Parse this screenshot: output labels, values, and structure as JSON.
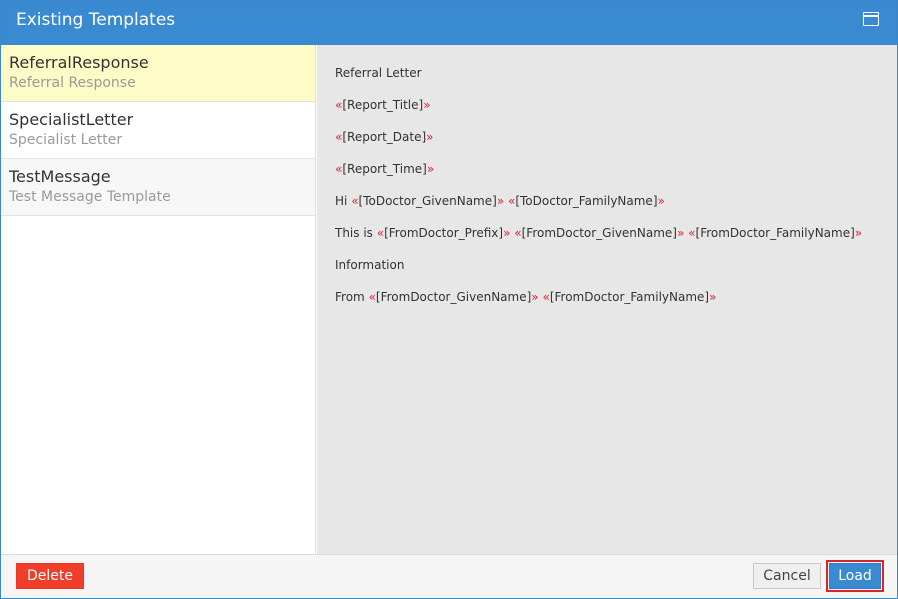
{
  "window": {
    "title": "Existing Templates",
    "accent": "#3a8ad2",
    "maximize_icon": "maximize-icon"
  },
  "templates": [
    {
      "name": "ReferralResponse",
      "description": "Referral Response",
      "selected": true
    },
    {
      "name": "SpecialistLetter",
      "description": "Specialist Letter",
      "selected": false
    },
    {
      "name": "TestMessage",
      "description": "Test Message Template",
      "selected": false
    }
  ],
  "preview": {
    "line1": "Referral Letter",
    "report_title": "[Report_Title]",
    "report_date": "[Report_Date]",
    "report_time": "[Report_Time]",
    "hi": "Hi",
    "to_given": "[ToDoctor_GivenName]",
    "to_family": "[ToDoctor_FamilyName]",
    "this_is": "This is",
    "from_prefix": "[FromDoctor_Prefix]",
    "from_given": "[FromDoctor_GivenName]",
    "from_family": "[FromDoctor_FamilyName]",
    "information": "Information",
    "from": "From",
    "open_quote": "«",
    "close_quote": "»",
    "merge_field_color": "#e0242f"
  },
  "footer": {
    "delete_label": "Delete",
    "cancel_label": "Cancel",
    "load_label": "Load",
    "delete_color": "#ef3e29"
  }
}
